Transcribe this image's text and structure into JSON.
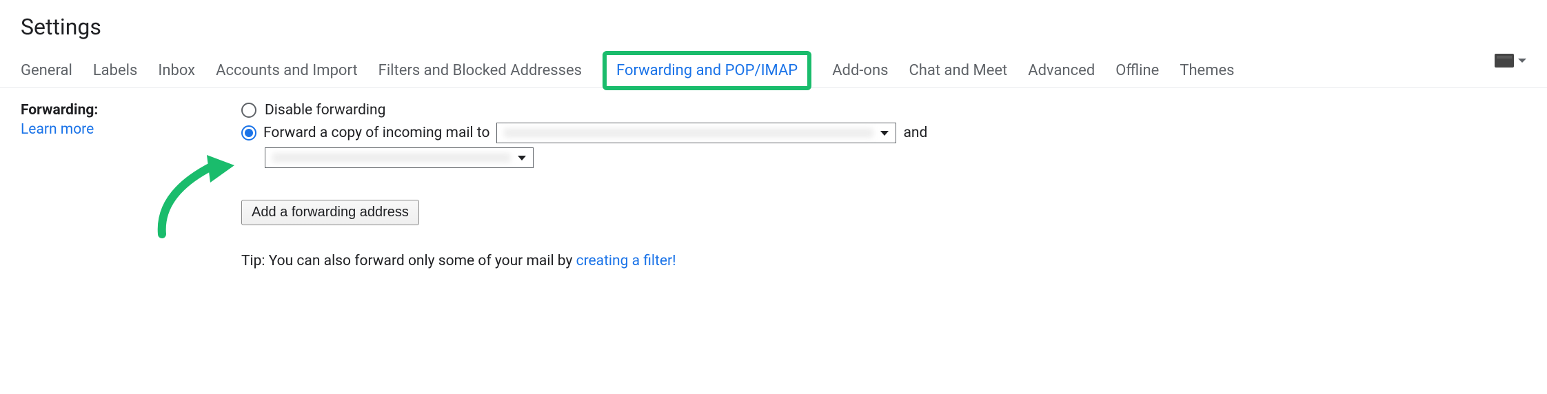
{
  "header": {
    "title": "Settings"
  },
  "tabs": [
    {
      "label": "General",
      "active": false
    },
    {
      "label": "Labels",
      "active": false
    },
    {
      "label": "Inbox",
      "active": false
    },
    {
      "label": "Accounts and Import",
      "active": false
    },
    {
      "label": "Filters and Blocked Addresses",
      "active": false
    },
    {
      "label": "Forwarding and POP/IMAP",
      "active": true,
      "highlighted": true
    },
    {
      "label": "Add-ons",
      "active": false
    },
    {
      "label": "Chat and Meet",
      "active": false
    },
    {
      "label": "Advanced",
      "active": false
    },
    {
      "label": "Offline",
      "active": false
    },
    {
      "label": "Themes",
      "active": false
    }
  ],
  "forwarding": {
    "section_label": "Forwarding:",
    "learn_more": "Learn more",
    "disable_label": "Disable forwarding",
    "forward_label": "Forward a copy of incoming mail to",
    "and_text": "and",
    "add_button_label": "Add a forwarding address",
    "tip_prefix": "Tip: You can also forward only some of your mail by ",
    "tip_link": "creating a filter!",
    "selected_option": "forward"
  }
}
